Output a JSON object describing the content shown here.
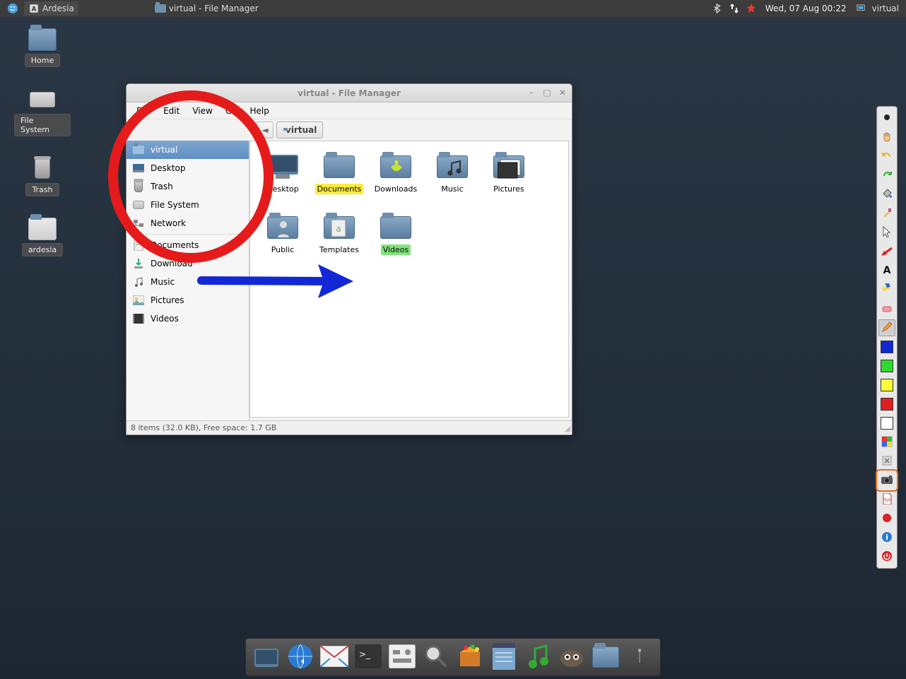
{
  "panel": {
    "ardesia_label": "Ardesia",
    "taskbar_label": "virtual - File Manager",
    "clock": "Wed, 07 Aug  00:22",
    "user": "virtual"
  },
  "desktop_icons": [
    {
      "name": "home",
      "label": "Home"
    },
    {
      "name": "filesystem",
      "label": "File System"
    },
    {
      "name": "trash",
      "label": "Trash"
    },
    {
      "name": "ardesia",
      "label": "ardesia"
    }
  ],
  "window": {
    "title": "virtual - File Manager",
    "menu": [
      "File",
      "Edit",
      "View",
      "Go",
      "Help"
    ],
    "path_label": "virtual",
    "sidebar": [
      {
        "name": "virtual",
        "label": "virtual",
        "active": true
      },
      {
        "name": "desktop",
        "label": "Desktop"
      },
      {
        "name": "trash",
        "label": "Trash"
      },
      {
        "name": "filesystem",
        "label": "File System"
      },
      {
        "name": "network",
        "label": "Network"
      },
      {
        "sep": true
      },
      {
        "name": "documents",
        "label": "Documents"
      },
      {
        "name": "download",
        "label": "Download"
      },
      {
        "name": "music",
        "label": "Music"
      },
      {
        "name": "pictures",
        "label": "Pictures"
      },
      {
        "name": "videos",
        "label": "Videos"
      }
    ],
    "files": [
      {
        "name": "desktop",
        "label": "Desktop"
      },
      {
        "name": "documents",
        "label": "Documents",
        "highlight": "yellow"
      },
      {
        "name": "downloads",
        "label": "Downloads"
      },
      {
        "name": "music",
        "label": "Music"
      },
      {
        "name": "pictures",
        "label": "Pictures"
      },
      {
        "name": "public",
        "label": "Public"
      },
      {
        "name": "templates",
        "label": "Templates"
      },
      {
        "name": "videos",
        "label": "Videos",
        "highlight": "green"
      }
    ],
    "status": "8 items (32.0 KB), Free space: 1.7 GB"
  },
  "ardesia_tools": [
    {
      "name": "thickness",
      "icon": "dot"
    },
    {
      "name": "hand",
      "icon": "hand"
    },
    {
      "name": "undo",
      "icon": "undo"
    },
    {
      "name": "redo",
      "icon": "redo"
    },
    {
      "name": "fill",
      "icon": "bucket"
    },
    {
      "name": "brush",
      "icon": "brush"
    },
    {
      "name": "pointer",
      "icon": "cursor"
    },
    {
      "name": "arrow",
      "icon": "arrow-red"
    },
    {
      "name": "text",
      "icon": "A"
    },
    {
      "name": "highlighter",
      "icon": "hl"
    },
    {
      "name": "eraser",
      "icon": "eraser"
    },
    {
      "name": "pencil",
      "icon": "pencil",
      "active": true
    },
    {
      "name": "color-blue",
      "swatch": "#1228d6"
    },
    {
      "name": "color-green",
      "swatch": "#2fd82f"
    },
    {
      "name": "color-yellow",
      "swatch": "#ffff33"
    },
    {
      "name": "color-red",
      "swatch": "#e02020"
    },
    {
      "name": "color-white",
      "swatch": "#ffffff"
    },
    {
      "name": "color-picker",
      "icon": "picker"
    },
    {
      "name": "clear",
      "icon": "clear"
    },
    {
      "name": "screenshot",
      "icon": "camera",
      "highlight": true
    },
    {
      "name": "export-pdf",
      "icon": "pdf"
    },
    {
      "name": "record",
      "icon": "rec"
    },
    {
      "name": "info",
      "icon": "info"
    },
    {
      "name": "quit",
      "icon": "power"
    }
  ],
  "dock": [
    "file-manager",
    "web-browser",
    "mail",
    "terminal",
    "settings",
    "search",
    "packages",
    "notes",
    "media",
    "gimp",
    "folder",
    "trash"
  ],
  "colors": {
    "annotation_red": "#e51b1b",
    "annotation_blue": "#1228d6",
    "hl_yellow": "#ffeb3b",
    "hl_green": "#82e37a"
  }
}
